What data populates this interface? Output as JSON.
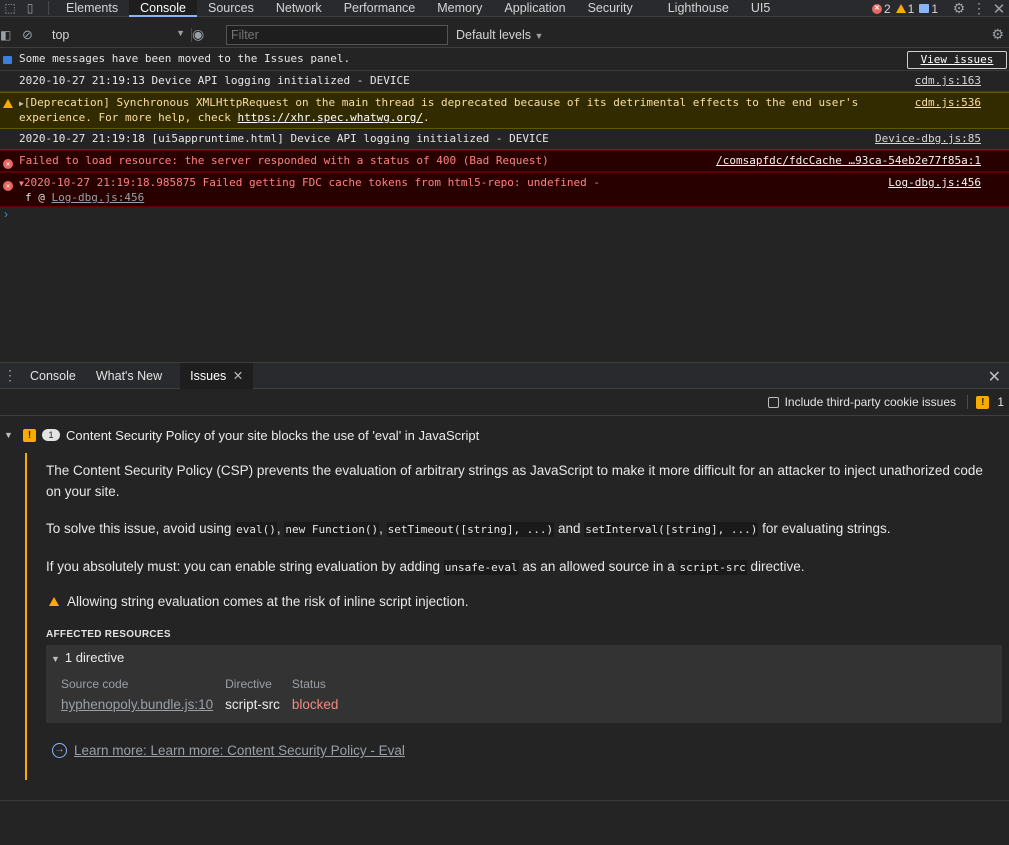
{
  "topbar": {
    "tabs": [
      "Elements",
      "Console",
      "Sources",
      "Network",
      "Performance",
      "Memory",
      "Application",
      "Security",
      "Lighthouse",
      "UI5"
    ],
    "active_tab": "Console",
    "error_count": "2",
    "warning_count": "1",
    "info_count": "1"
  },
  "console_toolbar": {
    "context": "top",
    "filter_placeholder": "Filter",
    "levels": "Default levels"
  },
  "messages": [
    {
      "type": "info",
      "text": "Some messages have been moved to the Issues panel.",
      "button": "View issues"
    },
    {
      "type": "log",
      "text": "2020-10-27 21:19:13 Device API logging initialized - DEVICE",
      "source": "cdm.js:163"
    },
    {
      "type": "warning",
      "text_line1": "[Deprecation] Synchronous XMLHttpRequest on the main thread is deprecated because of its detrimental effects to the end user's",
      "text_line2_prefix": "experience. For more help, check ",
      "link": "https://xhr.spec.whatwg.org/",
      "text_line2_suffix": ".",
      "source": "cdm.js:536"
    },
    {
      "type": "log",
      "text": "2020-10-27 21:19:18 [ui5appruntime.html] Device API logging initialized - DEVICE",
      "source": "Device-dbg.js:85"
    },
    {
      "type": "error",
      "text": "Failed to load resource: the server responded with a status of 400 (Bad Request)",
      "source": "/comsapfdc/fdcCache …93ca-54eb2e77f85a:1"
    },
    {
      "type": "error",
      "text": "2020-10-27 21:19:18.985875 Failed getting FDC cache tokens from html5-repo: undefined -",
      "source": "Log-dbg.js:456",
      "stack_prefix": "f @ ",
      "stack_link": "Log-dbg.js:456"
    }
  ],
  "drawer": {
    "tabs": [
      "Console",
      "What's New",
      "Issues"
    ],
    "active_tab": "Issues",
    "cookie_label": "Include third-party cookie issues",
    "issue_count": "1"
  },
  "issue": {
    "count": "1",
    "title": "Content Security Policy of your site blocks the use of 'eval' in JavaScript",
    "para1": "The Content Security Policy (CSP) prevents the evaluation of arbitrary strings as JavaScript to make it more difficult for an attacker to inject unathorized code on your site.",
    "para2": {
      "t1": "To solve this issue, avoid using ",
      "c1": "eval()",
      "t2": ", ",
      "c2": "new Function()",
      "t3": ", ",
      "c3": "setTimeout([string], ...)",
      "t4": " and ",
      "c4": "setInterval([string], ...)",
      "t5": " for evaluating strings."
    },
    "para3": {
      "t1": "If you absolutely must: you can enable string evaluation by adding ",
      "c1": "unsafe-eval",
      "t2": " as an allowed source in a ",
      "c2": "script-src",
      "t3": " directive."
    },
    "alert": "Allowing string evaluation comes at the risk of inline script injection.",
    "affected_title": "AFFECTED RESOURCES",
    "directive_count": "1 directive",
    "columns": [
      "Source code",
      "Directive",
      "Status"
    ],
    "row": {
      "source": "hyphenopoly.bundle.js:10",
      "directive": "script-src",
      "status": "blocked"
    },
    "learn_more": "Learn more: Learn more: Content Security Policy - Eval"
  }
}
